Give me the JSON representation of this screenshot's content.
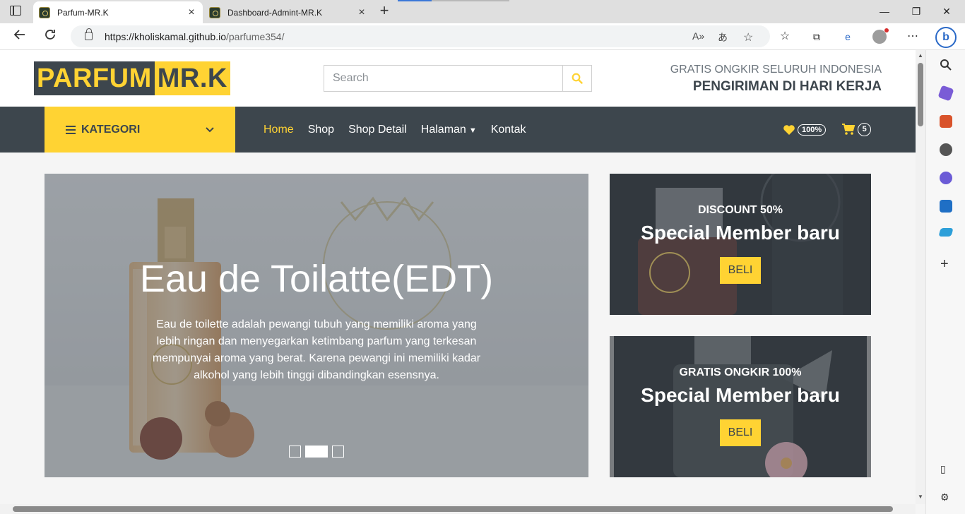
{
  "browser": {
    "tabs": [
      {
        "title": "Parfum-MR.K",
        "active": true
      },
      {
        "title": "Dashboard-Admint-MR.K",
        "active": false
      }
    ],
    "url_host": "https://kholiskamal.github.io",
    "url_path": "/parfume354/"
  },
  "header": {
    "logo_part1": "PARFUM",
    "logo_part2": "MR.K",
    "search_placeholder": "Search",
    "promo_line1": "GRATIS ONGKIR SELURUH INDONESIA",
    "promo_line2": "PENGIRIMAN DI HARI KERJA"
  },
  "nav": {
    "kategori_label": "KATEGORI",
    "items": [
      "Home",
      "Shop",
      "Shop Detail",
      "Halaman",
      "Kontak"
    ],
    "wishlist_badge": "100%",
    "cart_badge": "5"
  },
  "carousel": {
    "title": "Eau de Toilatte(EDT)",
    "text": "Eau de toilette adalah pewangi tubuh yang memiliki aroma yang lebih ringan dan menyegarkan ketimbang parfum yang terkesan mempunyai aroma yang berat. Karena pewangi ini memiliki kadar alkohol yang lebih tinggi dibandingkan esensnya."
  },
  "offers": [
    {
      "subtitle": "DISCOUNT 50%",
      "title": "Special Member baru",
      "button": "BELI"
    },
    {
      "subtitle": "GRATIS ONGKIR 100%",
      "title": "Special Member baru",
      "button": "BELI"
    }
  ],
  "colors": {
    "primary": "#ffd333",
    "dark": "#3d464d"
  }
}
